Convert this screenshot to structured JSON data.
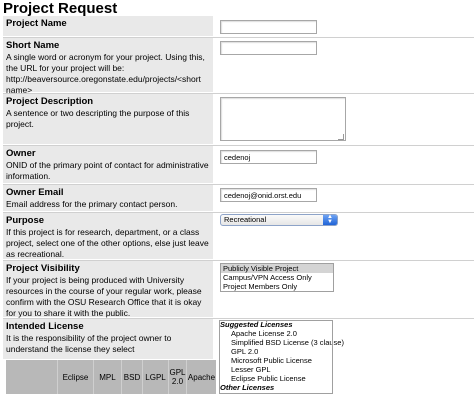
{
  "page": {
    "title": "Project Request"
  },
  "fields": {
    "project_name": {
      "label": "Project Name",
      "value": ""
    },
    "short_name": {
      "label": "Short Name",
      "desc": "A single word or acronym for your project. Using this, the URL for your project will be: http://beaversource.oregonstate.edu/projects/<short name>",
      "value": ""
    },
    "description": {
      "label": "Project Description",
      "desc": "A sentence or two descripting the purpose of this project.",
      "value": ""
    },
    "owner": {
      "label": "Owner",
      "desc": "ONID of the primary point of contact for administrative information.",
      "value": "cedenoj"
    },
    "owner_email": {
      "label": "Owner Email",
      "desc": "Email address for the primary contact person.",
      "value": "cedenoj@onid.orst.edu"
    },
    "purpose": {
      "label": "Purpose",
      "desc": "If this project is for research, department, or a class project, select one of the other options, else just leave as recreational.",
      "selected": "Recreational"
    },
    "visibility": {
      "label": "Project Visibility",
      "desc": "If your project is being produced with University resources in the course of your regular work, please confirm with the OSU Research Office that it is okay for you to share it with the public.",
      "options": [
        "Publicly Visible Project",
        "Campus/VPN Access Only",
        "Project Members Only"
      ],
      "selected_index": 0
    },
    "license": {
      "label": "Intended License",
      "desc": "It is the responsibility of the project owner to understand the license they select",
      "groups": [
        {
          "name": "Suggested Licenses",
          "options": [
            "Apache License 2.0",
            "Simplified BSD License (3 clause)",
            "GPL 2.0",
            "Microsoft Public License",
            "Lesser GPL",
            "Eclipse Public License"
          ]
        },
        {
          "name": "Other Licenses",
          "options": []
        }
      ],
      "table_headers": [
        "",
        "Eclipse",
        "MPL",
        "BSD",
        "LGPL",
        "GPL 2.0",
        "Apache"
      ]
    }
  },
  "colors": {
    "label_bg": "#e9e9e9",
    "selected_bg": "#d4d4d4",
    "select_arrow": "#1f63d6"
  }
}
